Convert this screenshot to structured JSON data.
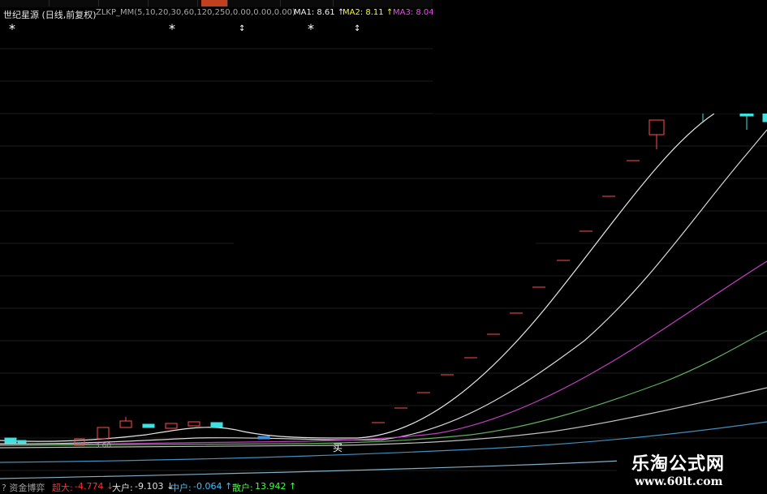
{
  "header": {
    "title": "世纪星源 (日线,前复权)",
    "params": "ZLKP_MM(5,10,20,30,60,120,250,0.00,0.00,0.00)",
    "ma1": "MA1: 8.61 ↑",
    "ma2": "MA2: 8.11 ↑",
    "ma3": "MA3: 8.04"
  },
  "markers": {
    "star": "*",
    "updown": "↕",
    "price_label": "3.60",
    "buy_label": "买"
  },
  "status": {
    "menu": "? 资金博弈",
    "big_label": "超大:",
    "big_value": "-4.774 ↓",
    "large_label": "大户:",
    "large_value": "-9.103 ↓",
    "mid_label": "中户:",
    "mid_value": "-0.064 ↑",
    "small_label": "散户:",
    "small_value": "13.942 ↑"
  },
  "watermark": {
    "title": "乐淘公式网",
    "url": "www.60lt.com"
  },
  "colors": {
    "background": "#000000",
    "grid": "#202020",
    "up_candle": "#ff4040",
    "down_candle": "#40e0e0",
    "ma_white": "#e0e0e0",
    "ma_magenta": "#c040c0",
    "ma_green": "#60c060",
    "ma_blue": "#4090c0"
  }
}
